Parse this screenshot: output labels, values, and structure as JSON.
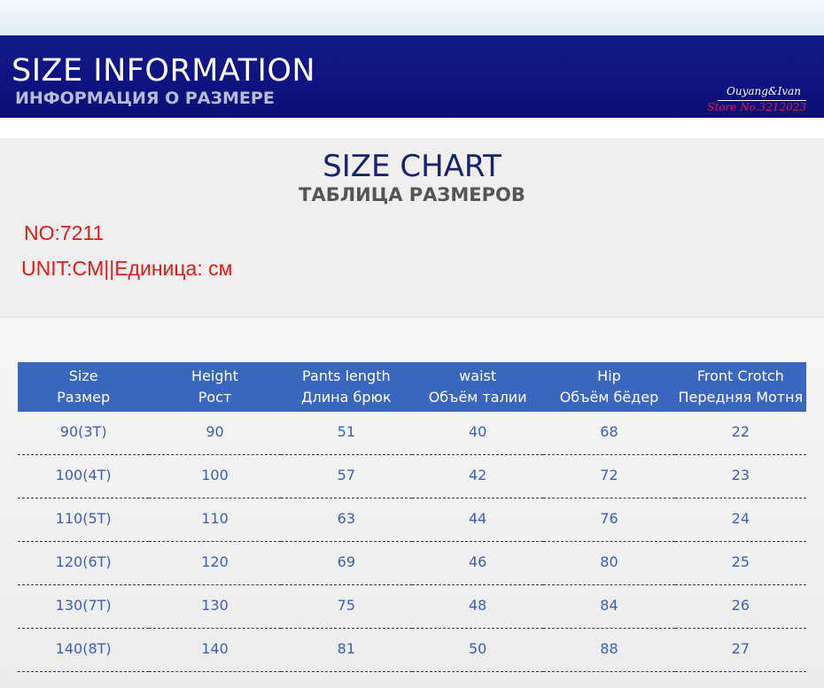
{
  "banner": {
    "title": "SIZE INFORMATION",
    "subtitle": "ИНФОРМАЦИЯ О РАЗМЕРЕ",
    "brand": "Ouyang&Ivan",
    "store": "Store No.3212023"
  },
  "chart": {
    "title": "SIZE CHART",
    "subtitle": "ТАБЛИЦА РАЗМЕРОВ",
    "number": "NO:7211",
    "unit": "UNIT:CM||Единица: см"
  },
  "table": {
    "headers": [
      {
        "en": "Size",
        "ru": "Размер"
      },
      {
        "en": "Height",
        "ru": "Рост"
      },
      {
        "en": "Pants length",
        "ru": "Длина брюк"
      },
      {
        "en": "waist",
        "ru": "Объём талии"
      },
      {
        "en": "Hip",
        "ru": "Объём бёдер"
      },
      {
        "en": "Front Crotch",
        "ru": "Передняя Мотня"
      }
    ],
    "rows": [
      [
        "90(3T)",
        "90",
        "51",
        "40",
        "68",
        "22"
      ],
      [
        "100(4T)",
        "100",
        "57",
        "42",
        "72",
        "23"
      ],
      [
        "110(5T)",
        "110",
        "63",
        "44",
        "76",
        "24"
      ],
      [
        "120(6T)",
        "120",
        "69",
        "46",
        "80",
        "25"
      ],
      [
        "130(7T)",
        "130",
        "75",
        "48",
        "84",
        "26"
      ],
      [
        "140(8T)",
        "140",
        "81",
        "50",
        "88",
        "27"
      ]
    ]
  },
  "colors": {
    "banner": "#0e1380",
    "header_row": "#3a66c0",
    "cell_text": "#3e60b2",
    "red_text": "#e11a1a"
  }
}
